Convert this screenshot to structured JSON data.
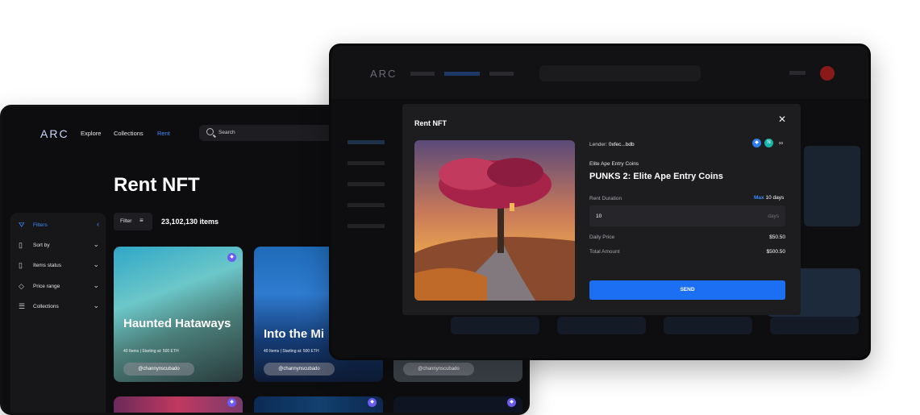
{
  "back_window": {
    "logo": "ARC",
    "nav": {
      "explore": "Explore",
      "collections": "Collections",
      "rent": "Rent"
    },
    "search_placeholder": "Search",
    "page_title": "Rent NFT",
    "filter_label": "Filter",
    "items_count": "23,102,130 items",
    "sidebar": [
      {
        "label": "Filters",
        "icon": "filter-icon"
      },
      {
        "label": "Sort by",
        "icon": "bag-icon"
      },
      {
        "label": "Items status",
        "icon": "bag-icon"
      },
      {
        "label": "Price range",
        "icon": "tag-icon"
      },
      {
        "label": "Collections",
        "icon": "list-icon"
      }
    ],
    "cards": [
      {
        "title": "Haunted Hataways",
        "meta": "40 Items | Starting at: 500 ETH",
        "creator": "@channynscubado"
      },
      {
        "title": "Into the Mi",
        "meta": "40 Items | Starting at: 500 ETH",
        "creator": "@channynscubado"
      },
      {
        "title": "",
        "meta": "",
        "creator": "@channynscubado"
      }
    ]
  },
  "modal": {
    "title": "Rent NFT",
    "lender_label": "Lender:",
    "lender_value": "0xfec...bdb",
    "collection": "Elite Ape Entry Coins",
    "item_title": "PUNKS 2: Elite Ape Entry Coins",
    "rent_duration_label": "Rent Duration",
    "max_label": "Max",
    "max_value": "10 days",
    "duration_value": "10",
    "duration_unit": "days",
    "daily_price_label": "Daily Price",
    "daily_price_value": "$50.50",
    "total_amount_label": "Total Amount",
    "total_amount_value": "$500.50",
    "send_label": "SEND",
    "social_icons": [
      "eth-icon",
      "n-icon",
      "link-icon"
    ]
  },
  "colors": {
    "accent": "#3d8bff",
    "send_button": "#1c6ef3",
    "background": "#0d0d0f"
  }
}
